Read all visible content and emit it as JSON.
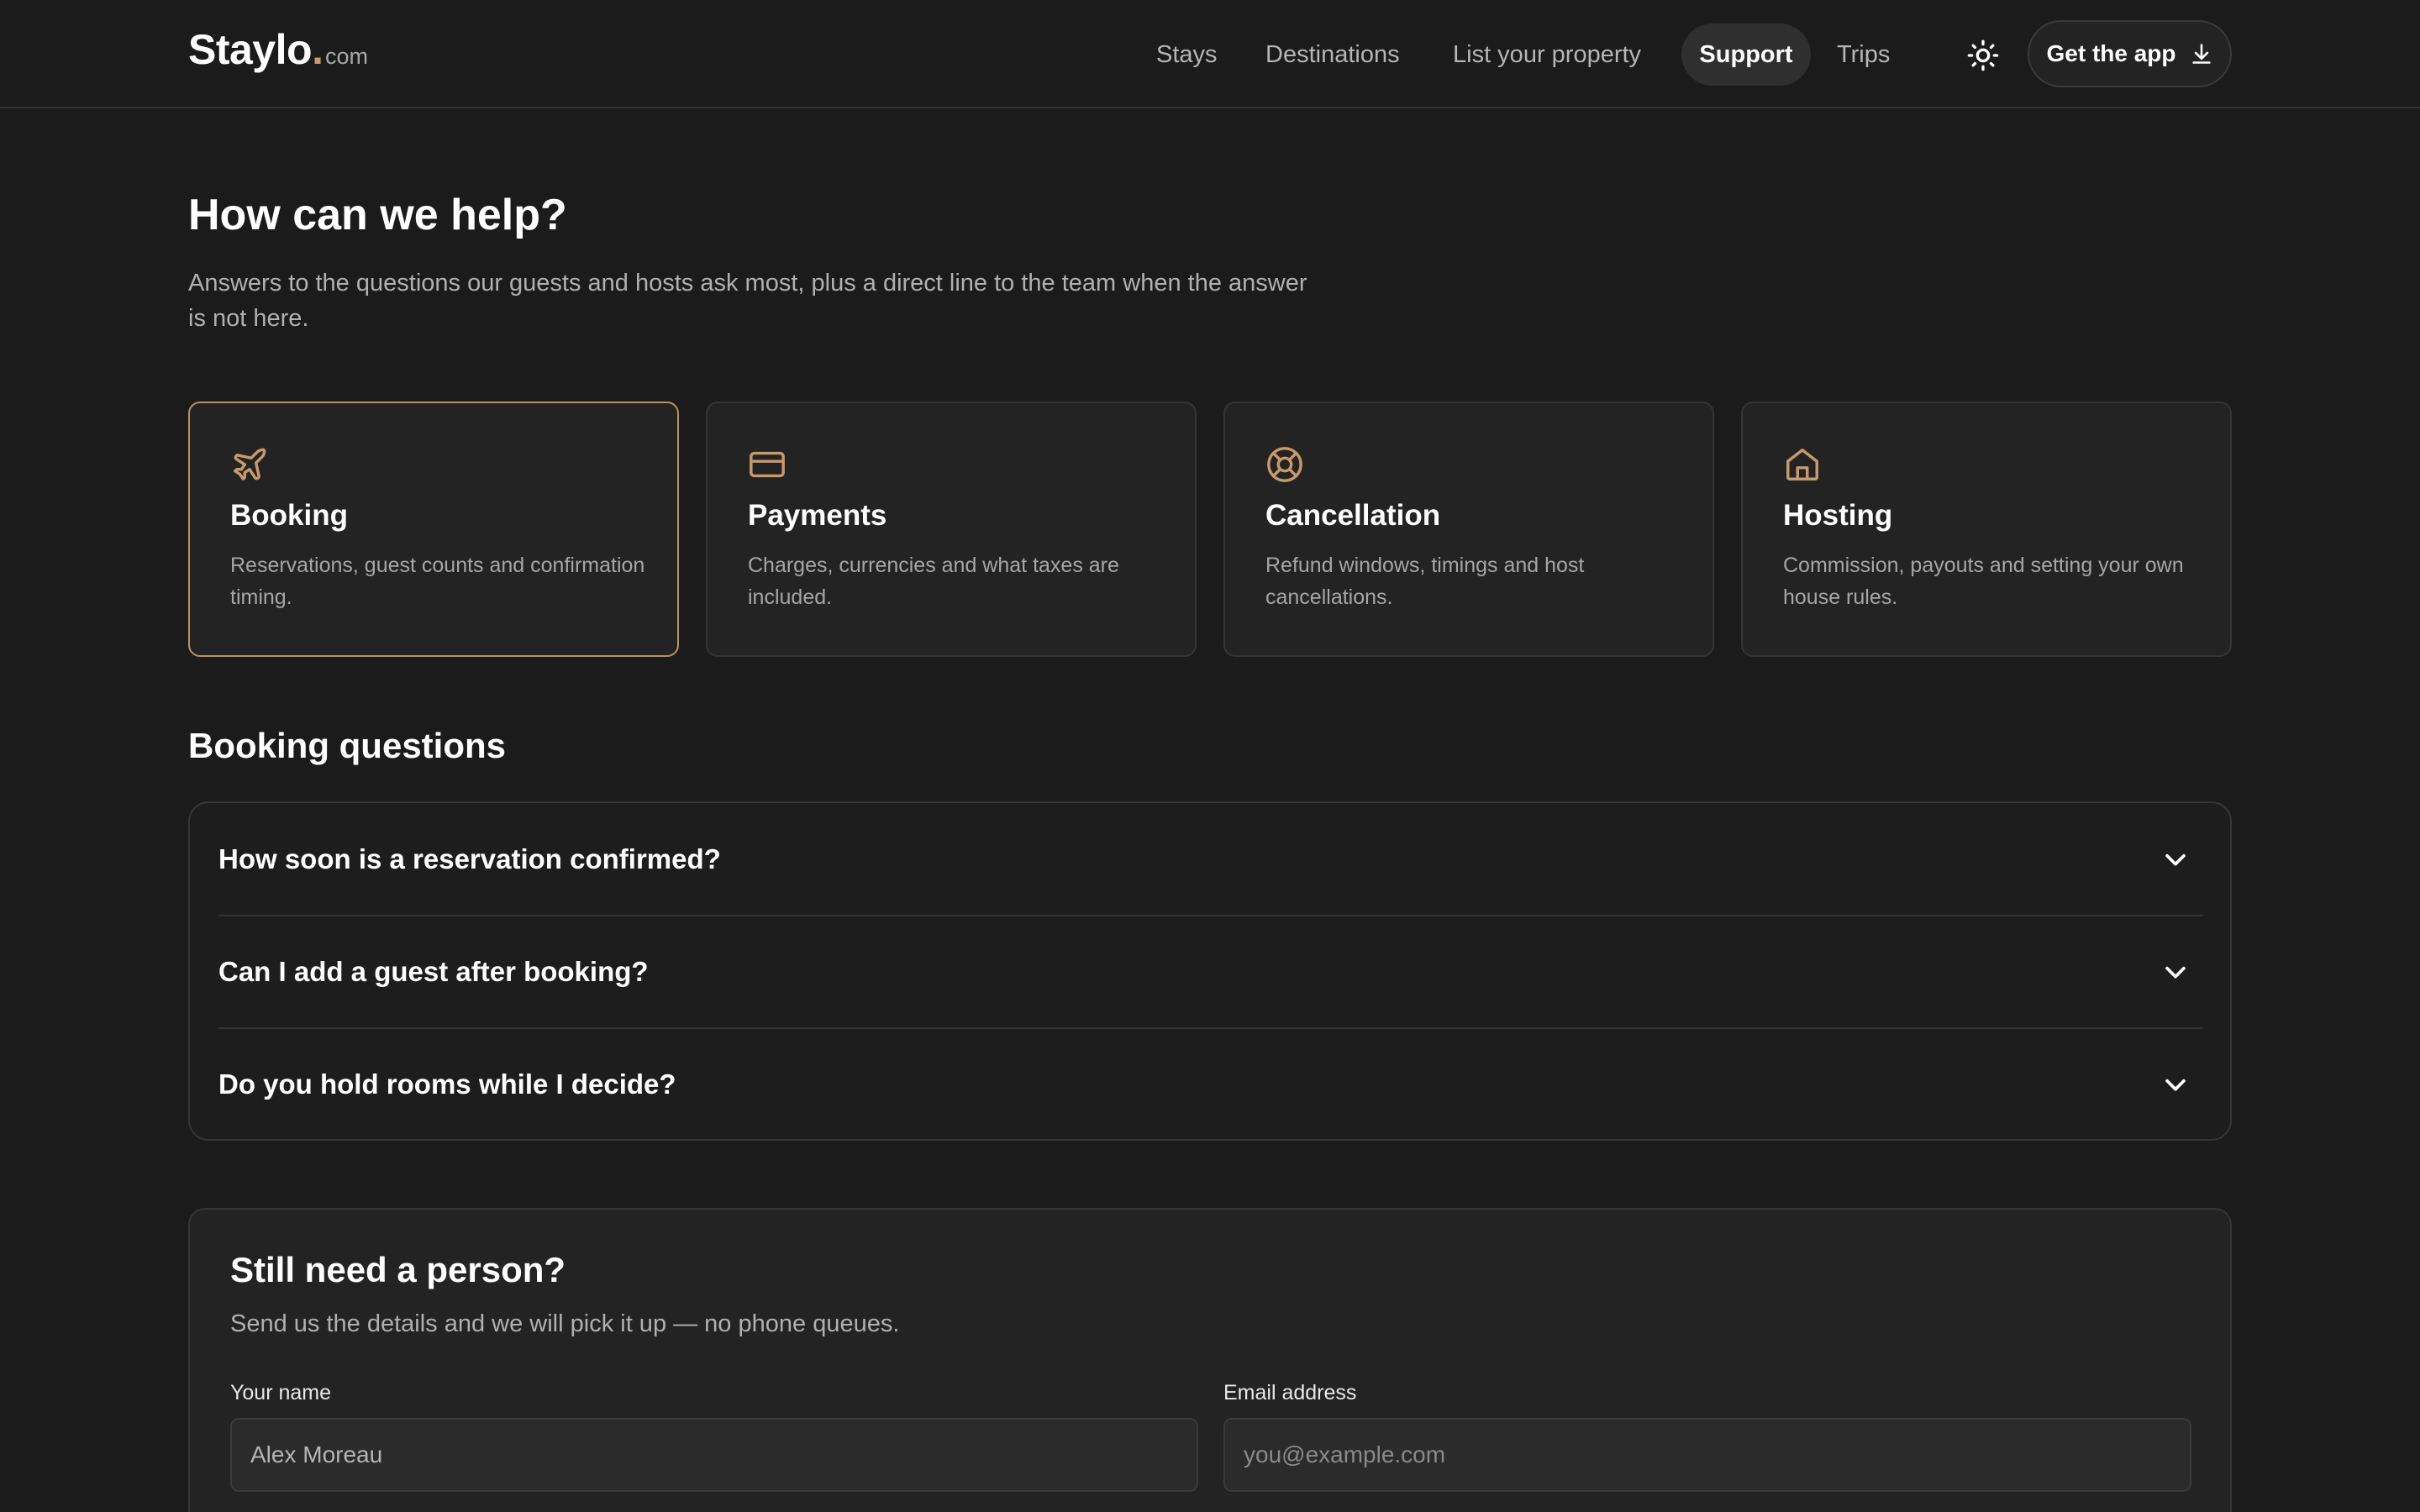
{
  "header": {
    "logo_main": "Staylo",
    "logo_dot": ".",
    "logo_suffix": "com",
    "nav": [
      "Stays",
      "Destinations",
      "List your property",
      "Support",
      "Trips"
    ],
    "active_nav": "Support",
    "get_app_label": "Get the app"
  },
  "hero": {
    "title": "How can we help?",
    "subtitle": "Answers to the questions our guests and hosts ask most, plus a direct line to the team when the answer is not here."
  },
  "categories": [
    {
      "title": "Booking",
      "description": "Reservations, guest counts and confirmation timing.",
      "icon": "plane-icon",
      "selected": true
    },
    {
      "title": "Payments",
      "description": "Charges, currencies and what taxes are included.",
      "icon": "credit-card-icon",
      "selected": false
    },
    {
      "title": "Cancellation",
      "description": "Refund windows, timings and host cancellations.",
      "icon": "life-buoy-icon",
      "selected": false
    },
    {
      "title": "Hosting",
      "description": "Commission, payouts and setting your own house rules.",
      "icon": "house-icon",
      "selected": false
    }
  ],
  "faq": {
    "title": "Booking questions",
    "questions": [
      "How soon is a reservation confirmed?",
      "Can I add a guest after booking?",
      "Do you hold rooms while I decide?"
    ]
  },
  "contact": {
    "title": "Still need a person?",
    "subtitle": "Send us the details and we will pick it up — no phone queues.",
    "name_label": "Your name",
    "name_value": "Alex Moreau",
    "email_label": "Email address",
    "email_placeholder": "you@example.com"
  },
  "colors": {
    "accent": "#c89a6a",
    "background": "#1b1b1b",
    "card": "#232323"
  }
}
